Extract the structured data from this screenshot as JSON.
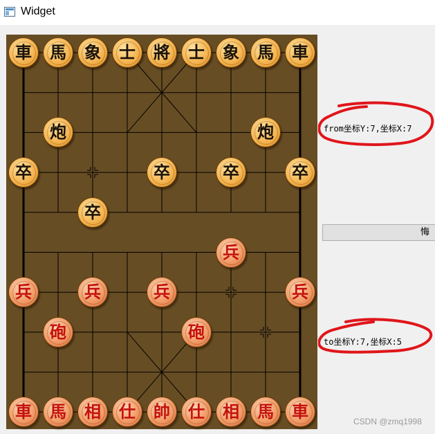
{
  "window": {
    "title": "Widget",
    "icon": "window-app-icon"
  },
  "board": {
    "colors": {
      "background": "#674d24",
      "lines": "#000000"
    },
    "columns": 9,
    "rows": 10,
    "pieces": [
      {
        "char": "車",
        "side": "black",
        "col": 0,
        "row": 0
      },
      {
        "char": "馬",
        "side": "black",
        "col": 1,
        "row": 0
      },
      {
        "char": "象",
        "side": "black",
        "col": 2,
        "row": 0
      },
      {
        "char": "士",
        "side": "black",
        "col": 3,
        "row": 0
      },
      {
        "char": "將",
        "side": "black",
        "col": 4,
        "row": 0
      },
      {
        "char": "士",
        "side": "black",
        "col": 5,
        "row": 0
      },
      {
        "char": "象",
        "side": "black",
        "col": 6,
        "row": 0
      },
      {
        "char": "馬",
        "side": "black",
        "col": 7,
        "row": 0
      },
      {
        "char": "車",
        "side": "black",
        "col": 8,
        "row": 0
      },
      {
        "char": "炮",
        "side": "black",
        "col": 1,
        "row": 2
      },
      {
        "char": "炮",
        "side": "black",
        "col": 7,
        "row": 2
      },
      {
        "char": "卒",
        "side": "black",
        "col": 0,
        "row": 3
      },
      {
        "char": "卒",
        "side": "black",
        "col": 4,
        "row": 3
      },
      {
        "char": "卒",
        "side": "black",
        "col": 6,
        "row": 3
      },
      {
        "char": "卒",
        "side": "black",
        "col": 8,
        "row": 3
      },
      {
        "char": "卒",
        "side": "black",
        "col": 2,
        "row": 4
      },
      {
        "char": "兵",
        "side": "red",
        "col": 6,
        "row": 5
      },
      {
        "char": "兵",
        "side": "red",
        "col": 0,
        "row": 6
      },
      {
        "char": "兵",
        "side": "red",
        "col": 2,
        "row": 6
      },
      {
        "char": "兵",
        "side": "red",
        "col": 4,
        "row": 6
      },
      {
        "char": "兵",
        "side": "red",
        "col": 8,
        "row": 6
      },
      {
        "char": "砲",
        "side": "red",
        "col": 1,
        "row": 7
      },
      {
        "char": "砲",
        "side": "red",
        "col": 5,
        "row": 7
      },
      {
        "char": "車",
        "side": "red",
        "col": 0,
        "row": 9
      },
      {
        "char": "馬",
        "side": "red",
        "col": 1,
        "row": 9
      },
      {
        "char": "相",
        "side": "red",
        "col": 2,
        "row": 9
      },
      {
        "char": "仕",
        "side": "red",
        "col": 3,
        "row": 9
      },
      {
        "char": "帥",
        "side": "red",
        "col": 4,
        "row": 9
      },
      {
        "char": "仕",
        "side": "red",
        "col": 5,
        "row": 9
      },
      {
        "char": "相",
        "side": "red",
        "col": 6,
        "row": 9
      },
      {
        "char": "馬",
        "side": "red",
        "col": 7,
        "row": 9
      },
      {
        "char": "車",
        "side": "red",
        "col": 8,
        "row": 9
      }
    ]
  },
  "labels": {
    "from": "from坐标Y:7,坐标X:7",
    "to": "to坐标Y:7,坐标X:5"
  },
  "undo_button": {
    "label": "悔"
  },
  "annotation": {
    "color": "#e0151a"
  },
  "watermark": "CSDN @zmq1998"
}
